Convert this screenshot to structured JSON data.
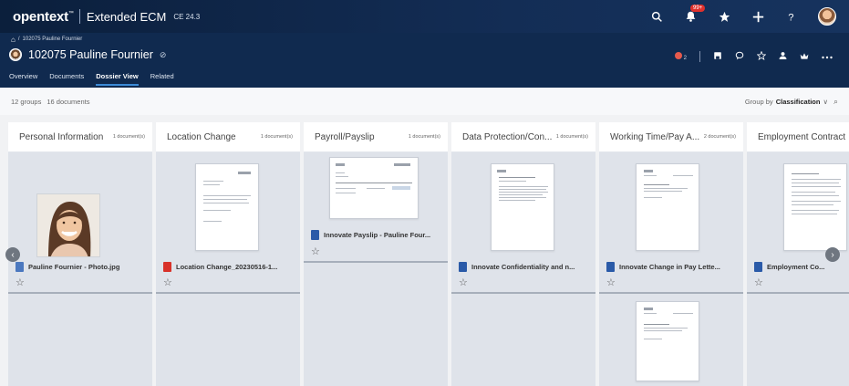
{
  "header": {
    "brand": "opentext",
    "brand_tm": "™",
    "product": "Extended ECM",
    "version": "CE 24.3",
    "notification_count": "99+",
    "icons": [
      "search-icon",
      "bell-icon",
      "star-icon",
      "plus-icon",
      "help-icon",
      "avatar"
    ]
  },
  "breadcrumb": {
    "home": "⌂",
    "separator": "/",
    "item": "102075 Pauline Fournier"
  },
  "workspace": {
    "title": "102075 Pauline Fournier",
    "title_suffix": "⊘",
    "status_count": "2",
    "tabs": [
      {
        "label": "Overview"
      },
      {
        "label": "Documents"
      },
      {
        "label": "Dossier View",
        "active": true
      },
      {
        "label": "Related"
      }
    ]
  },
  "toolbar": {
    "groups": "12 groups",
    "documents": "16 documents",
    "group_by_label": "Group by",
    "group_by_value": "Classification",
    "chevron": "∨",
    "search": "⌕"
  },
  "columns": [
    {
      "title": "Personal Information",
      "count": "1 document(s)",
      "cards": [
        {
          "file": "Pauline Fournier - Photo.jpg",
          "type": "img"
        }
      ]
    },
    {
      "title": "Location Change",
      "count": "1 document(s)",
      "cards": [
        {
          "file": "Location Change_20230516-1...",
          "type": "pdf"
        }
      ]
    },
    {
      "title": "Payroll/Payslip",
      "count": "1 document(s)",
      "cards": [
        {
          "file": "Innovate Payslip - Pauline Four...",
          "type": "word"
        }
      ]
    },
    {
      "title": "Data Protection/Con...",
      "count": "1 document(s)",
      "cards": [
        {
          "file": "Innovate Confidentiality and n...",
          "type": "word"
        }
      ]
    },
    {
      "title": "Working Time/Pay A...",
      "count": "2 document(s)",
      "cards": [
        {
          "file": "Innovate Change in Pay Lette...",
          "type": "word"
        }
      ]
    },
    {
      "title": "Employment Contract",
      "count": "",
      "cards": [
        {
          "file": "Employment Co...",
          "type": "word"
        }
      ]
    }
  ],
  "icons": {
    "star": "☆",
    "left_arrow": "‹",
    "right_arrow": "›"
  }
}
